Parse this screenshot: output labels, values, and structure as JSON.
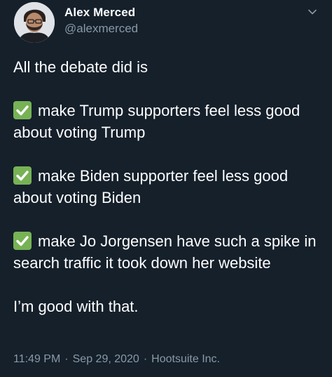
{
  "author": {
    "display_name": "Alex Merced",
    "handle": "@alexmerced"
  },
  "tweet": {
    "intro": "All the debate did is",
    "items": [
      {
        "icon": "check-mark-icon",
        "text": "make Trump supporters feel less good about voting Trump"
      },
      {
        "icon": "check-mark-icon",
        "text": "make Biden supporter feel less good about voting Biden"
      },
      {
        "icon": "check-mark-icon",
        "text": "make Jo Jorgensen have such a spike in search traffic it took down her website"
      }
    ],
    "closing": "I’m good with that."
  },
  "meta": {
    "time": "11:49 PM",
    "date": "Sep 29, 2020",
    "source": "Hootsuite Inc.",
    "separator": "·"
  },
  "colors": {
    "background": "#15202b",
    "text": "#ffffff",
    "secondary": "#8899a6",
    "check": "#77b255"
  }
}
